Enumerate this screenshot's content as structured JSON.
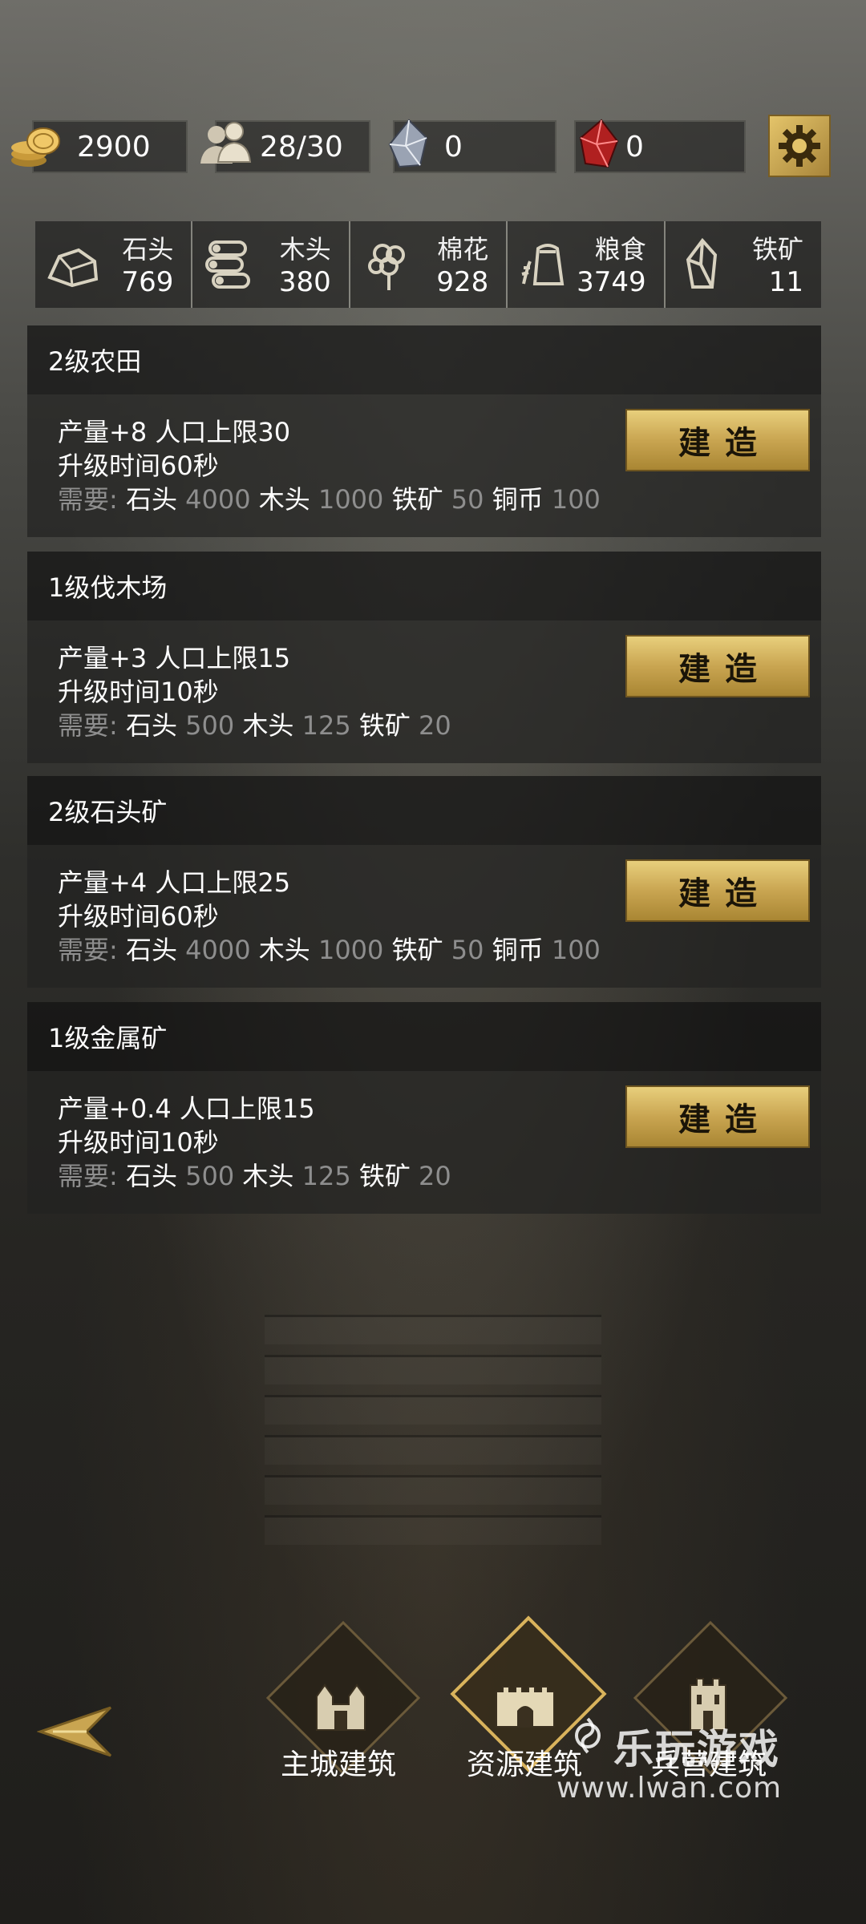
{
  "top_bar": {
    "coins": "2900",
    "population": "28/30",
    "crystal": "0",
    "ruby": "0"
  },
  "resources": [
    {
      "name": "石头",
      "amount": "769",
      "icon": "stone-icon"
    },
    {
      "name": "木头",
      "amount": "380",
      "icon": "wood-icon"
    },
    {
      "name": "棉花",
      "amount": "928",
      "icon": "cotton-icon"
    },
    {
      "name": "粮食",
      "amount": "3749",
      "icon": "grain-icon"
    },
    {
      "name": "铁矿",
      "amount": "11",
      "icon": "iron-ore-icon"
    }
  ],
  "buildings": [
    {
      "title": "2级农田",
      "effect": "产量+8 人口上限30",
      "time": "升级时间60秒",
      "req_label": "需要:",
      "req": [
        [
          "石头",
          "4000"
        ],
        [
          "木头",
          "1000"
        ],
        [
          "铁矿",
          "50"
        ],
        [
          "铜币",
          "100"
        ]
      ],
      "button": "建造"
    },
    {
      "title": "1级伐木场",
      "effect": "产量+3 人口上限15",
      "time": "升级时间10秒",
      "req_label": "需要:",
      "req": [
        [
          "石头",
          "500"
        ],
        [
          "木头",
          "125"
        ],
        [
          "铁矿",
          "20"
        ]
      ],
      "button": "建造"
    },
    {
      "title": "2级石头矿",
      "effect": "产量+4 人口上限25",
      "time": "升级时间60秒",
      "req_label": "需要:",
      "req": [
        [
          "石头",
          "4000"
        ],
        [
          "木头",
          "1000"
        ],
        [
          "铁矿",
          "50"
        ],
        [
          "铜币",
          "100"
        ]
      ],
      "button": "建造"
    },
    {
      "title": "1级金属矿",
      "effect": "产量+0.4 人口上限15",
      "time": "升级时间10秒",
      "req_label": "需要:",
      "req": [
        [
          "石头",
          "500"
        ],
        [
          "木头",
          "125"
        ],
        [
          "铁矿",
          "20"
        ]
      ],
      "button": "建造"
    }
  ],
  "nav": {
    "main_city": "主城建筑",
    "resource": "资源建筑",
    "barracks": "兵营建筑",
    "active": "resource"
  },
  "watermark": {
    "brand": "乐玩游戏",
    "url": "www.lwan.com"
  },
  "colors": {
    "gold": "#d9b35c",
    "button_gold": "#c9a551",
    "requirement_gray": "#8e8e8e"
  }
}
